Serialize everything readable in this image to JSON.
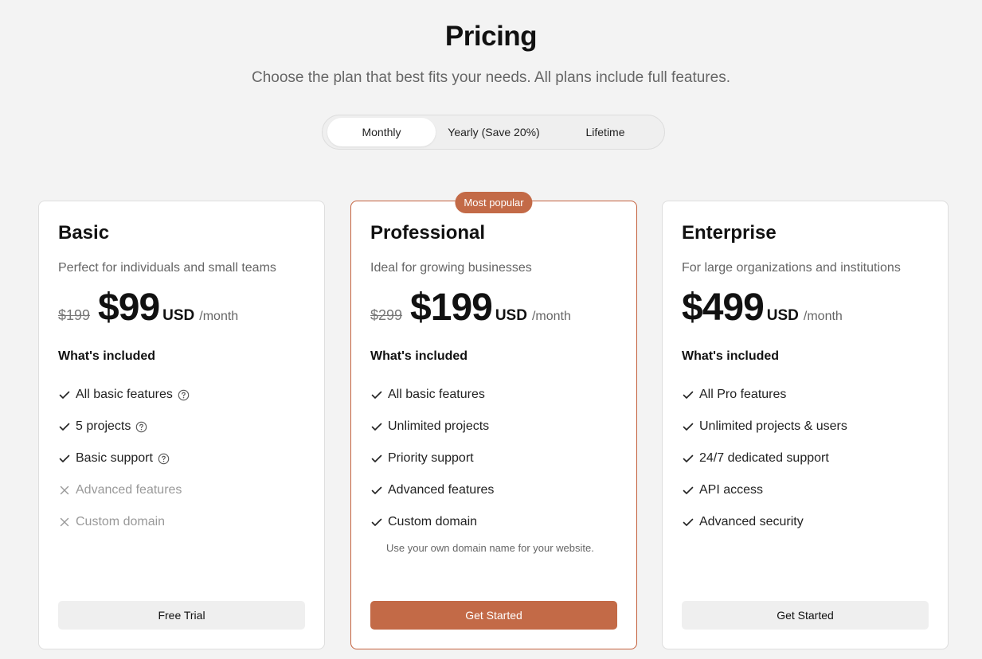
{
  "page": {
    "title": "Pricing",
    "subtitle": "Choose the plan that best fits your needs. All plans include full features."
  },
  "billing_toggle": {
    "options": [
      "Monthly",
      "Yearly (Save 20%)",
      "Lifetime"
    ],
    "selected": "Monthly"
  },
  "colors": {
    "accent": "#c36a47",
    "background": "#f3f3f3"
  },
  "plans": [
    {
      "name": "Basic",
      "description": "Perfect for individuals and small teams",
      "old_price": "$199",
      "price": "$99",
      "currency": "USD",
      "period": "/month",
      "included_label": "What's included",
      "features": [
        {
          "label": "All basic features",
          "included": true,
          "help": true
        },
        {
          "label": "5 projects",
          "included": true,
          "help": true
        },
        {
          "label": "Basic support",
          "included": true,
          "help": true
        },
        {
          "label": "Advanced features",
          "included": false,
          "help": false
        },
        {
          "label": "Custom domain",
          "included": false,
          "help": false
        }
      ],
      "cta": "Free Trial"
    },
    {
      "name": "Professional",
      "badge": "Most popular",
      "description": "Ideal for growing businesses",
      "old_price": "$299",
      "price": "$199",
      "currency": "USD",
      "period": "/month",
      "included_label": "What's included",
      "features": [
        {
          "label": "All basic features",
          "included": true,
          "help": false
        },
        {
          "label": "Unlimited projects",
          "included": true,
          "help": false
        },
        {
          "label": "Priority support",
          "included": true,
          "help": false
        },
        {
          "label": "Advanced features",
          "included": true,
          "help": false
        },
        {
          "label": "Custom domain",
          "included": true,
          "help": false
        }
      ],
      "note": "Use your own domain name for your website.",
      "cta": "Get Started"
    },
    {
      "name": "Enterprise",
      "description": "For large organizations and institutions",
      "price": "$499",
      "currency": "USD",
      "period": "/month",
      "included_label": "What's included",
      "features": [
        {
          "label": "All Pro features",
          "included": true,
          "help": false
        },
        {
          "label": "Unlimited projects & users",
          "included": true,
          "help": false
        },
        {
          "label": "24/7 dedicated support",
          "included": true,
          "help": false
        },
        {
          "label": "API access",
          "included": true,
          "help": false
        },
        {
          "label": "Advanced security",
          "included": true,
          "help": false
        }
      ],
      "cta": "Get Started"
    }
  ]
}
